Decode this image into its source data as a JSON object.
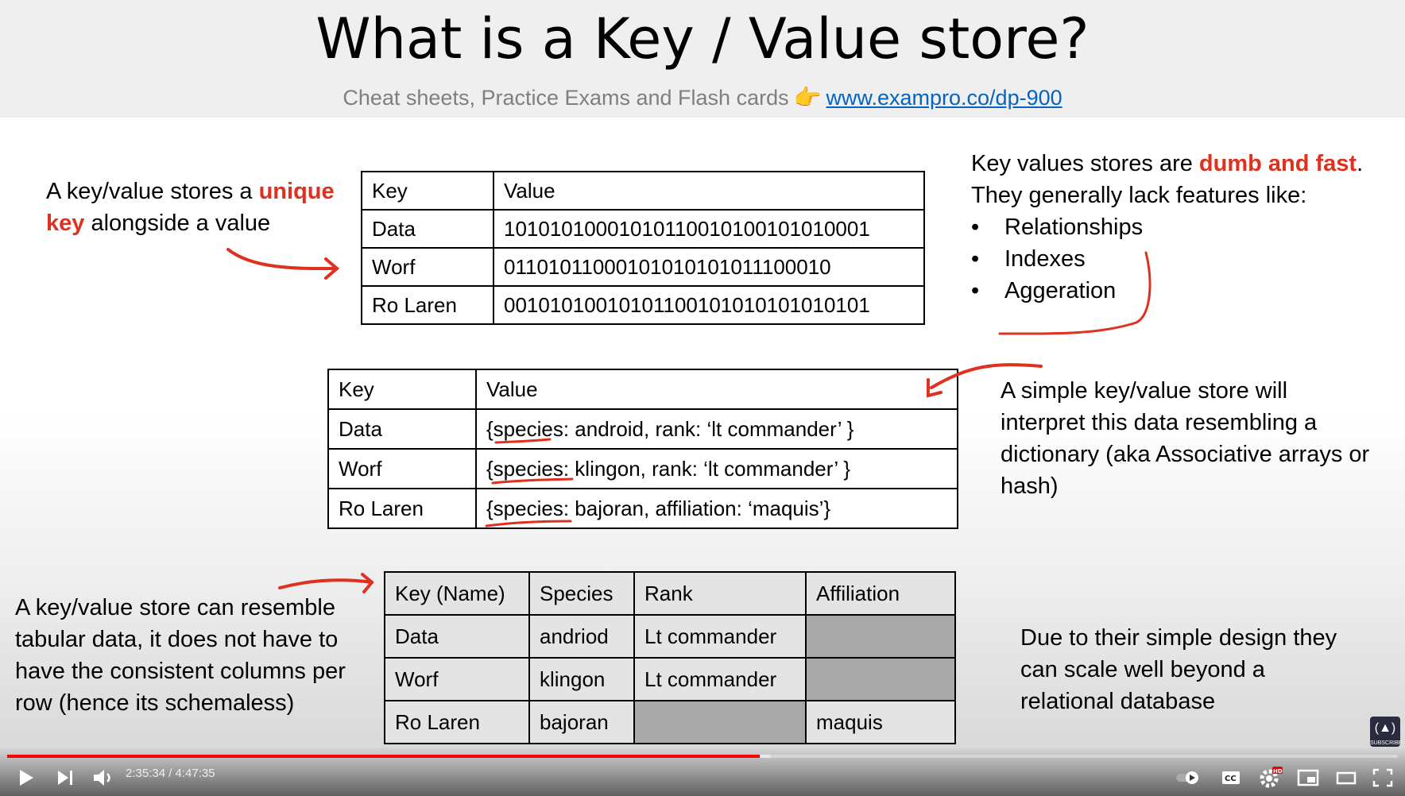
{
  "slide": {
    "title": "What is a Key / Value store?",
    "subtitle_text": "Cheat sheets, Practice Exams and Flash cards",
    "subtitle_link": "www.exampro.co/dp-900",
    "left_top": {
      "part1": "A key/value stores a ",
      "highlight": "unique key",
      "part2": " alongside a value"
    },
    "right_top": {
      "line1_a": "Key values stores are ",
      "line1_highlight": "dumb and fast",
      "line1_b": ".",
      "line2": "They generally lack features like:",
      "features": [
        "Relationships",
        "Indexes",
        "Aggeration"
      ]
    },
    "right_middle": "A simple key/value store will interpret this data resembling a dictionary (aka Associative arrays or hash)",
    "left_bottom": "A key/value store can resemble tabular data, it does not have to have the consistent columns per row (hence its schemaless)",
    "right_bottom": "Due to their simple design they can scale well beyond a relational database",
    "table1": {
      "headers": [
        "Key",
        "Value"
      ],
      "rows": [
        [
          "Data",
          "10101010001010110010100101010001"
        ],
        [
          "Worf",
          "01101011000101010101011100010"
        ],
        [
          "Ro Laren",
          "00101010010101100101010101010101"
        ]
      ]
    },
    "table2": {
      "headers": [
        "Key",
        "Value"
      ],
      "rows": [
        [
          "Data",
          "{species: android, rank: ‘lt commander’ }"
        ],
        [
          "Worf",
          "{species: klingon, rank: ‘lt commander’ }"
        ],
        [
          "Ro Laren",
          "{species: bajoran, affiliation: ‘maquis’}"
        ]
      ]
    },
    "table3": {
      "headers": [
        "Key (Name)",
        "Species",
        "Rank",
        "Affiliation"
      ],
      "rows": [
        [
          "Data",
          "andriod",
          "Lt commander",
          ""
        ],
        [
          "Worf",
          "klingon",
          "Lt commander",
          ""
        ],
        [
          "Ro Laren",
          "bajoran",
          "",
          "maquis"
        ]
      ]
    },
    "badge_label": "SUBSCRIBE",
    "ink_color": "#e0301e"
  },
  "player": {
    "time_display": "2:35:34 / 4:47:35",
    "progress": 0.541,
    "progress_color": "#ff0000",
    "icons": [
      "play-icon",
      "next-icon",
      "volume-icon",
      "autoplay-toggle",
      "captions-icon",
      "settings-icon",
      "miniplayer-icon",
      "theater-icon",
      "fullscreen-icon"
    ]
  }
}
